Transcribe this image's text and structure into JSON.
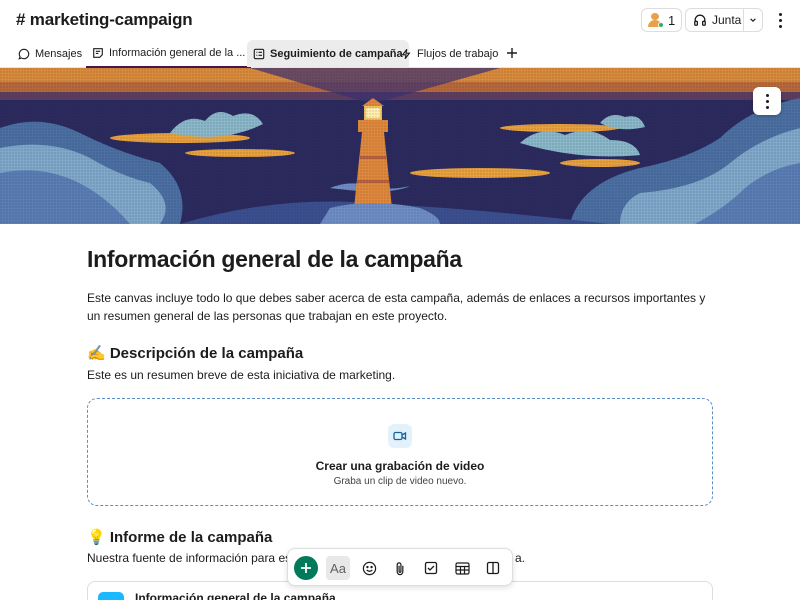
{
  "header": {
    "channel_name": "# marketing-campaign",
    "members_count": "1",
    "huddle_label": "Junta"
  },
  "tabs": [
    {
      "label": "Mensajes",
      "icon": "message-icon"
    },
    {
      "label": "Información general de la ...",
      "icon": "canvas-icon"
    },
    {
      "label": "Seguimiento de campaña",
      "icon": "list-icon"
    },
    {
      "label": "Flujos de trabajo",
      "icon": "workflow-icon"
    }
  ],
  "document": {
    "title": "Información general de la campaña",
    "intro": "Este canvas incluye todo lo que debes saber acerca de esta campaña, además de enlaces a recursos importantes y un resumen general de las personas que trabajan en este proyecto.",
    "section1_heading": "✍️ Descripción de la campaña",
    "section1_text": "Este es un resumen breve de esta iniciativa de marketing.",
    "video_title": "Crear una grabación de video",
    "video_subtitle": "Graba un clip de video nuevo.",
    "section2_heading": "💡 Informe de la campaña",
    "section2_text_left": "Nuestra fuente de información para est",
    "section2_text_right": "a.",
    "card_title": "Información general de la campaña"
  },
  "toolbar": {
    "text_style_label": "Aa"
  },
  "colors": {
    "accent_tab": "#4a154b",
    "add_button": "#007a5a",
    "dashed_border": "#5b8fc7",
    "banner_sky": "#2b2a5c",
    "banner_sun": "#e9a23b"
  }
}
